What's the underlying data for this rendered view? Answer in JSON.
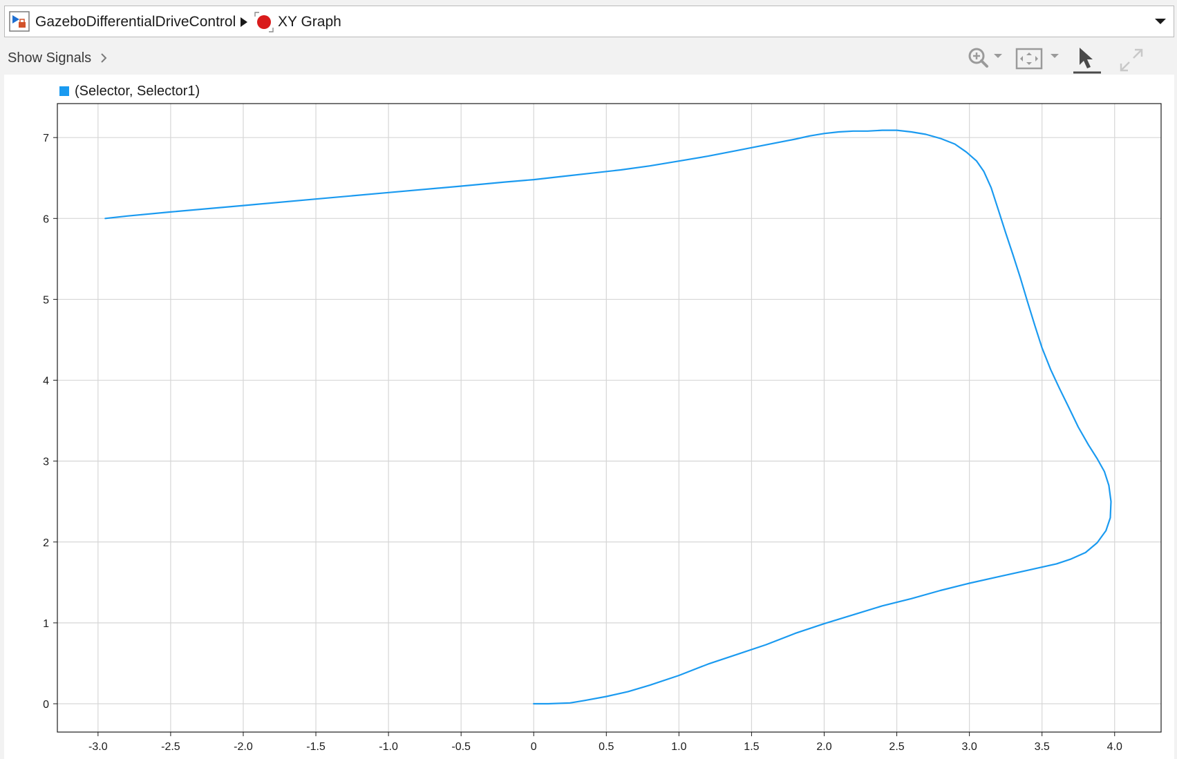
{
  "breadcrumb": {
    "model_name": "GazeboDifferentialDriveControl",
    "block_name": "XY Graph"
  },
  "toolbar": {
    "show_signals_label": "Show Signals",
    "icons": [
      "zoom-in-icon",
      "fit-to-view-icon",
      "cursor-select-icon",
      "expand-icon"
    ]
  },
  "colors": {
    "series": "#1a9af0",
    "block_status": "#d91c1c",
    "grid": "#d6d6d6"
  },
  "chart_data": {
    "type": "line",
    "series": [
      {
        "name": "(Selector, Selector1)",
        "x": [
          0.0,
          0.1,
          0.25,
          0.35,
          0.5,
          0.65,
          0.8,
          1.0,
          1.2,
          1.4,
          1.6,
          1.8,
          2.0,
          2.2,
          2.4,
          2.6,
          2.8,
          3.0,
          3.2,
          3.4,
          3.6,
          3.7,
          3.8,
          3.88,
          3.94,
          3.97,
          3.975,
          3.96,
          3.93,
          3.88,
          3.82,
          3.75,
          3.68,
          3.62,
          3.56,
          3.5,
          3.45,
          3.4,
          3.35,
          3.3,
          3.25,
          3.2,
          3.15,
          3.1,
          3.05,
          2.98,
          2.9,
          2.8,
          2.7,
          2.6,
          2.5,
          2.4,
          2.3,
          2.2,
          2.1,
          2.0,
          1.9,
          1.8,
          1.6,
          1.4,
          1.2,
          1.0,
          0.8,
          0.6,
          0.4,
          0.2,
          0.0,
          -0.2,
          -0.5,
          -1.0,
          -1.5,
          -2.0,
          -2.5,
          -2.8,
          -2.95
        ],
        "y": [
          0.0,
          0.0,
          0.01,
          0.04,
          0.09,
          0.15,
          0.23,
          0.35,
          0.49,
          0.61,
          0.73,
          0.87,
          0.99,
          1.1,
          1.21,
          1.3,
          1.4,
          1.49,
          1.57,
          1.65,
          1.73,
          1.79,
          1.87,
          1.99,
          2.14,
          2.3,
          2.5,
          2.7,
          2.87,
          3.03,
          3.2,
          3.42,
          3.68,
          3.9,
          4.13,
          4.4,
          4.68,
          4.97,
          5.27,
          5.55,
          5.82,
          6.1,
          6.38,
          6.58,
          6.71,
          6.82,
          6.92,
          6.99,
          7.04,
          7.07,
          7.09,
          7.09,
          7.08,
          7.08,
          7.07,
          7.05,
          7.02,
          6.98,
          6.91,
          6.84,
          6.77,
          6.71,
          6.65,
          6.6,
          6.56,
          6.52,
          6.48,
          6.45,
          6.4,
          6.32,
          6.24,
          6.16,
          6.08,
          6.03,
          6.0
        ]
      }
    ],
    "xlim": [
      -3.28,
      4.32
    ],
    "ylim": [
      -0.35,
      7.42
    ],
    "xticks": [
      -3.0,
      -2.5,
      -2.0,
      -1.5,
      -1.0,
      -0.5,
      0,
      0.5,
      1.0,
      1.5,
      2.0,
      2.5,
      3.0,
      3.5,
      4.0
    ],
    "xticklabels": [
      "-3.0",
      "-2.5",
      "-2.0",
      "-1.5",
      "-1.0",
      "-0.5",
      "0",
      "0.5",
      "1.0",
      "1.5",
      "2.0",
      "2.5",
      "3.0",
      "3.5",
      "4.0"
    ],
    "yticks": [
      0,
      1,
      2,
      3,
      4,
      5,
      6,
      7
    ],
    "yticklabels": [
      "0",
      "1",
      "2",
      "3",
      "4",
      "5",
      "6",
      "7"
    ],
    "grid": true,
    "legend": "top-left"
  }
}
